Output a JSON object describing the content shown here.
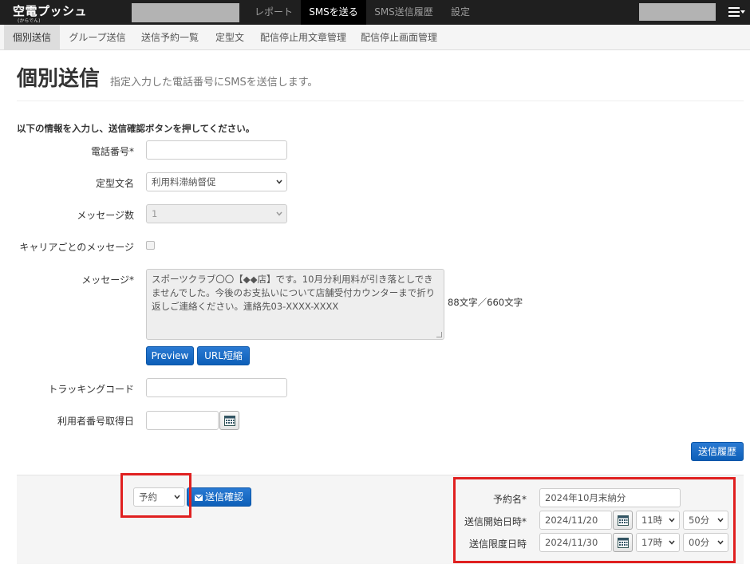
{
  "app": {
    "logo": "空電プッシュ",
    "logo_sub": "(からでん)"
  },
  "topnav": [
    {
      "label": "レポート"
    },
    {
      "label": "SMSを送る",
      "active": true
    },
    {
      "label": "SMS送信履歴"
    },
    {
      "label": "設定"
    }
  ],
  "subnav": [
    {
      "label": "個別送信",
      "active": true
    },
    {
      "label": "グループ送信"
    },
    {
      "label": "送信予約一覧"
    },
    {
      "label": "定型文"
    },
    {
      "label": "配信停止用文章管理"
    },
    {
      "label": "配信停止画面管理"
    }
  ],
  "page": {
    "title": "個別送信",
    "subtitle": "指定入力した電話番号にSMSを送信します。",
    "instruction": "以下の情報を入力し、送信確認ボタンを押してください。"
  },
  "form": {
    "phone": {
      "label": "電話番号*",
      "value": ""
    },
    "template": {
      "label": "定型文名",
      "value": "利用料滞納督促"
    },
    "message_count": {
      "label": "メッセージ数",
      "value": "1"
    },
    "carrier": {
      "label": "キャリアごとのメッセージ",
      "checked": false
    },
    "message": {
      "label": "メッセージ*",
      "value": "スポーツクラブ〇〇【◆◆店】です。10月分利用料が引き落としできませんでした。今後のお支払いについて店舗受付カウンターまで折り返しご連絡ください。連絡先03-XXXX-XXXX",
      "counter": "88文字／660文字"
    },
    "preview_button": "Preview",
    "url_shorten_button": "URL短縮",
    "tracking": {
      "label": "トラッキングコード",
      "value": ""
    },
    "acquired_date": {
      "label": "利用者番号取得日",
      "value": ""
    }
  },
  "history_button": "送信履歴",
  "footer": {
    "send_mode": "予約",
    "confirm_button": "送信確認",
    "reservation": {
      "name_label": "予約名*",
      "name_value": "2024年10月末納分",
      "start_label": "送信開始日時*",
      "start_date": "2024/11/20",
      "start_hour": "11時",
      "start_min": "50分",
      "end_label": "送信限度日時",
      "end_date": "2024/11/30",
      "end_hour": "17時",
      "end_min": "00分"
    }
  },
  "colors": {
    "accent": "#0d5fb8",
    "highlight": "#e02020",
    "topbar": "#1f1f1f"
  }
}
